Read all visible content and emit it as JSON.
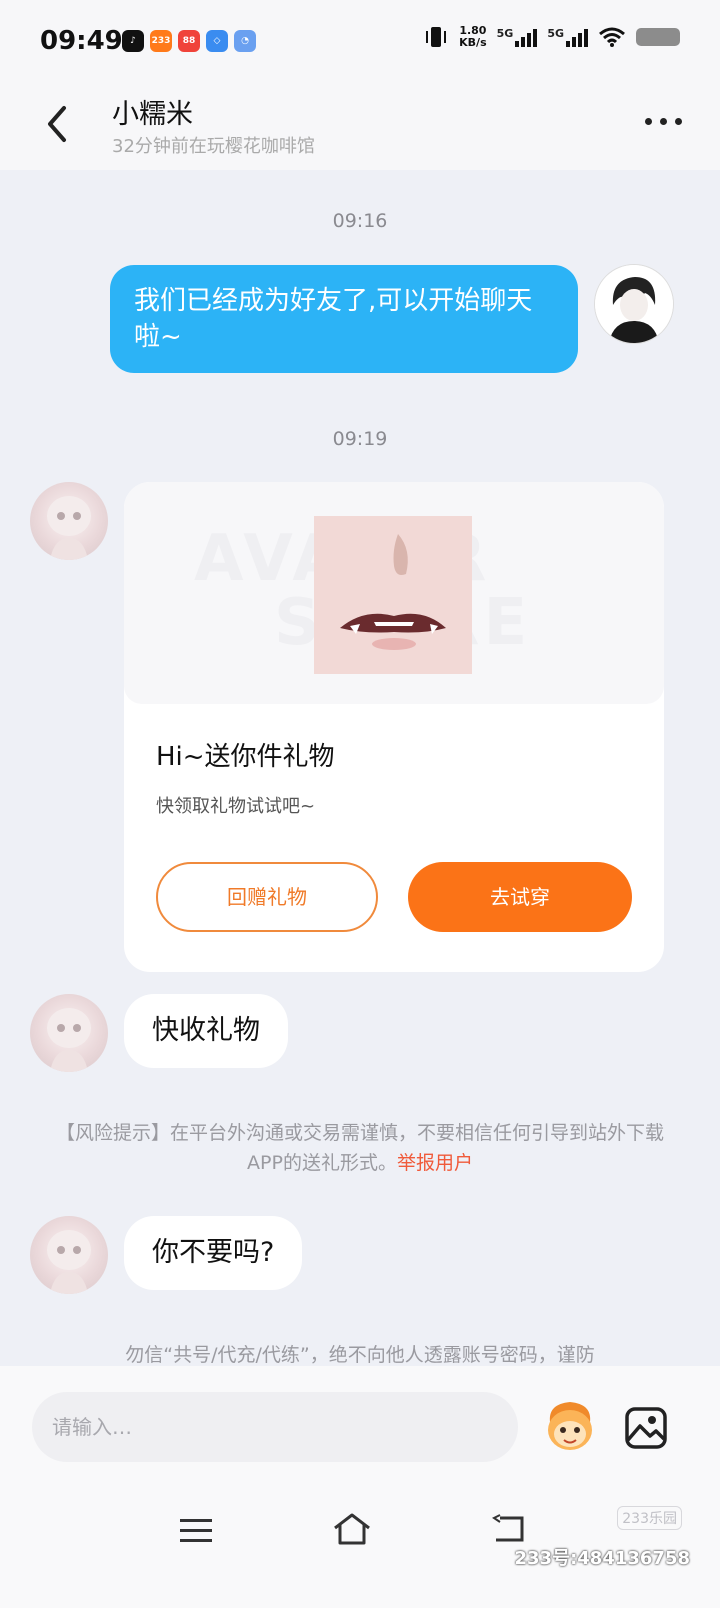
{
  "status_bar": {
    "time": "09:49",
    "app_icons": [
      {
        "name": "music-app-icon",
        "color": "#111111",
        "label": "♪"
      },
      {
        "name": "233-app-icon",
        "color": "#ff7a1a",
        "label": "233"
      },
      {
        "name": "red-app-icon",
        "color": "#f0433a",
        "label": "88"
      },
      {
        "name": "blue-app-icon",
        "color": "#3a8cf0",
        "label": "◇"
      },
      {
        "name": "doc-app-icon",
        "color": "#6aa0f0",
        "label": "◔"
      }
    ],
    "net_speed": "1.80",
    "net_unit": "KB/s",
    "signal1_label": "5G",
    "signal2_label": "5G"
  },
  "header": {
    "name": "小糯米",
    "status": "32分钟前在玩樱花咖啡馆"
  },
  "messages": {
    "time1": "09:16",
    "me_text": "我们已经成为好友了,可以开始聊天啦~",
    "time2": "09:19",
    "gift": {
      "watermark_top": "AVATAR",
      "watermark_bottom": "STORE",
      "title": "Hi~送你件礼物",
      "subtitle": "快领取礼物试试吧~",
      "return_button": "回赠礼物",
      "try_button": "去试穿"
    },
    "msg_collect": "快收礼物",
    "risk_text": "【风险提示】在平台外沟通或交易需谨慎，不要相信任何引导到站外下载APP的送礼形式。",
    "risk_link": "举报用户",
    "msg_question": "你不要吗?",
    "warn2": "勿信“共号/代充/代练”，绝不向他人透露账号密码，谨防"
  },
  "input": {
    "placeholder": "请输入…"
  },
  "watermark": {
    "badge": "233乐园",
    "id": "233号:484136758"
  },
  "colors": {
    "my_bubble": "#2cb3f6",
    "accent_orange": "#fb7317",
    "report_red": "#f05a3a"
  }
}
